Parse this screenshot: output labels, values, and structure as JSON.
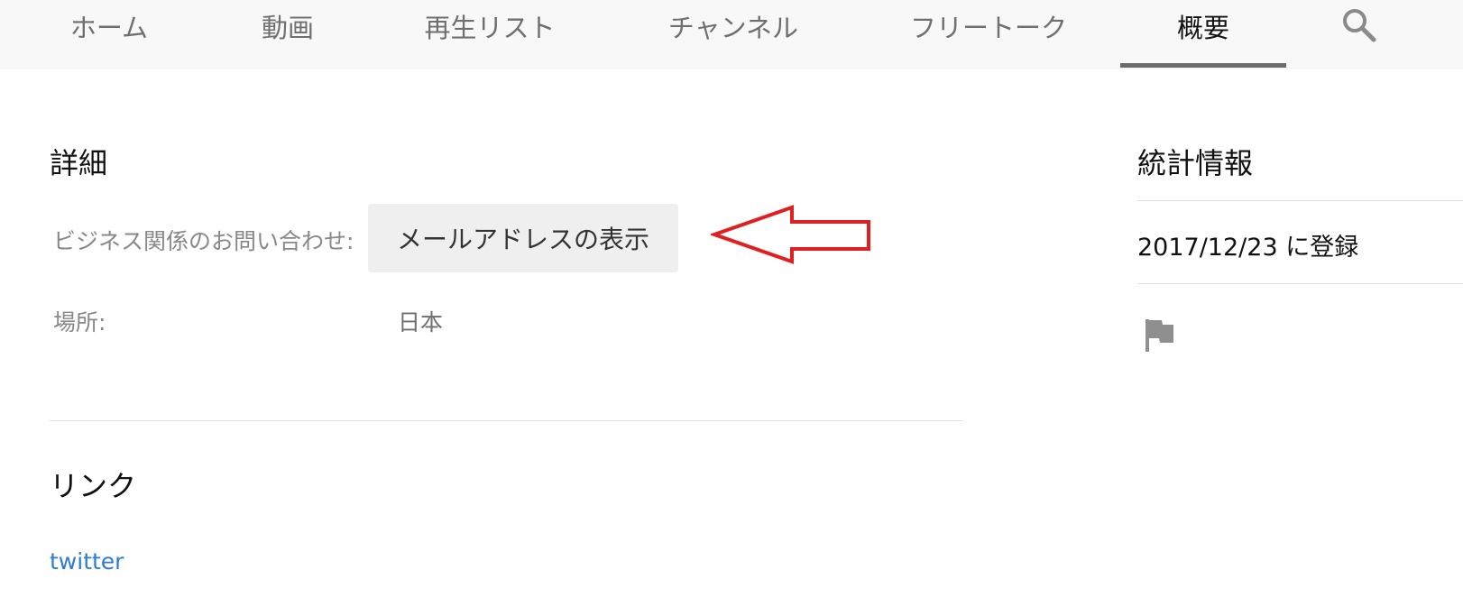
{
  "tabs": [
    {
      "label": "ホーム",
      "active": false
    },
    {
      "label": "動画",
      "active": false
    },
    {
      "label": "再生リスト",
      "active": false
    },
    {
      "label": "チャンネル",
      "active": false
    },
    {
      "label": "フリートーク",
      "active": false
    },
    {
      "label": "概要",
      "active": true
    }
  ],
  "details": {
    "title": "詳細",
    "business_label": "ビジネス関係のお問い合わせ:",
    "email_button": "メールアドレスの表示",
    "location_label": "場所:",
    "location_value": "日本"
  },
  "links": {
    "title": "リンク",
    "items": [
      "twitter"
    ]
  },
  "stats": {
    "title": "統計情報",
    "joined": "2017/12/23 に登録"
  },
  "icons": {
    "search": "search-icon",
    "flag": "flag-icon",
    "annotation": "red-arrow-annotation"
  },
  "colors": {
    "link": "#2c7bd6",
    "annotation": "#e02020",
    "tab_indicator": "#6b6b6b"
  }
}
